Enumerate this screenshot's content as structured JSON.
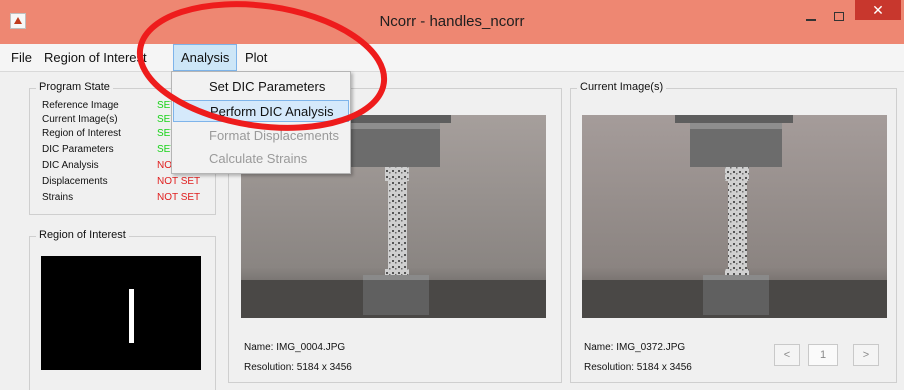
{
  "window": {
    "title": "Ncorr - handles_ncorr",
    "minimize_icon": "minimize-icon",
    "maximize_icon": "maximize-icon",
    "close_label": "✕"
  },
  "menu": {
    "file": "File",
    "region_of_interest": "Region of Interest",
    "analysis": "Analysis",
    "plot": "Plot"
  },
  "dropdown": {
    "items": [
      {
        "label": "Set DIC Parameters",
        "enabled": true
      },
      {
        "label": "Perform DIC Analysis",
        "enabled": true,
        "highlighted": true
      },
      {
        "label": "Format Displacements",
        "enabled": false
      },
      {
        "label": "Calculate Strains",
        "enabled": false
      }
    ]
  },
  "program_state": {
    "title": "Program State",
    "rows": [
      {
        "label": "Reference Image",
        "value": "SET"
      },
      {
        "label": "Current Image(s)",
        "value": "SET"
      },
      {
        "label": "Region of Interest",
        "value": "SET"
      },
      {
        "label": "DIC Parameters",
        "value": "SET"
      },
      {
        "label": "DIC Analysis",
        "value": "NOT SET"
      },
      {
        "label": "Displacements",
        "value": "NOT SET"
      },
      {
        "label": "Strains",
        "value": "NOT SET"
      }
    ],
    "colors": {
      "set": "#18d318",
      "not_set": "#e01e1e"
    }
  },
  "roi_panel": {
    "title": "Region of Interest"
  },
  "reference_panel": {
    "name": "Name: IMG_0004.JPG",
    "resolution": "Resolution: 5184 x 3456"
  },
  "current_panel": {
    "title": "Current Image(s)",
    "name": "Name: IMG_0372.JPG",
    "resolution": "Resolution: 5184 x 3456",
    "prev_label": "<",
    "page": "1",
    "next_label": ">"
  },
  "colors": {
    "titlebar": "#ee8772",
    "annotation": "#ee1c1c",
    "menu_highlight": "#cde6f7"
  }
}
